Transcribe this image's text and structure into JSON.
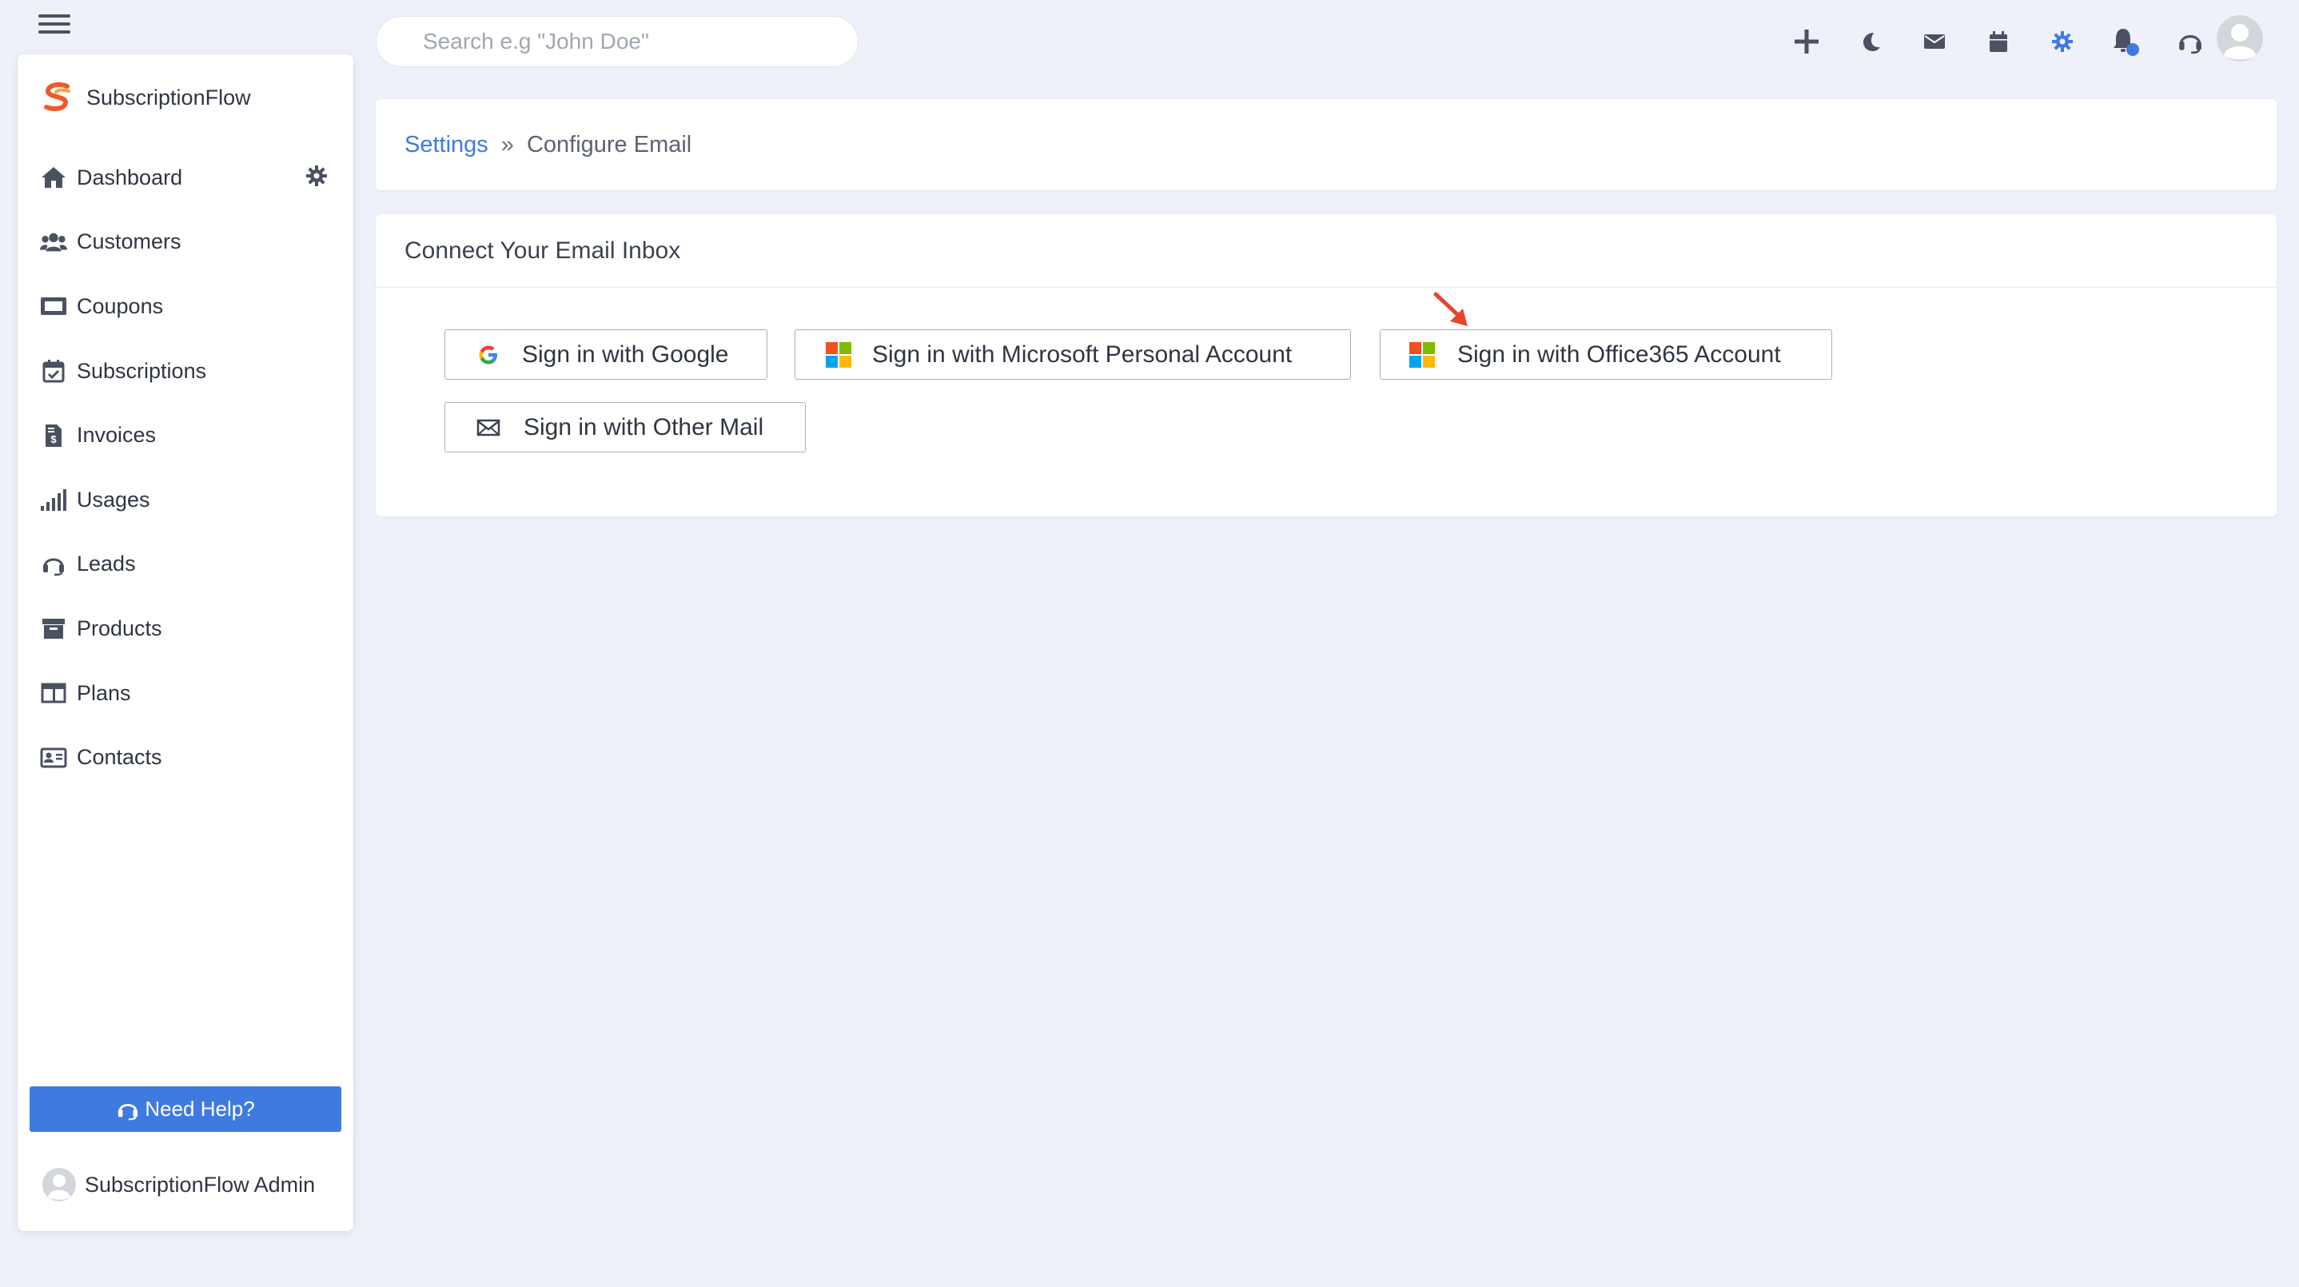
{
  "brand": {
    "name": "SubscriptionFlow"
  },
  "search": {
    "placeholder": "Search e.g \"John Doe\""
  },
  "sidebar": {
    "items": [
      {
        "label": "Dashboard",
        "icon": "home-icon"
      },
      {
        "label": "Customers",
        "icon": "users-icon"
      },
      {
        "label": "Coupons",
        "icon": "ticket-icon"
      },
      {
        "label": "Subscriptions",
        "icon": "calendar-check-icon"
      },
      {
        "label": "Invoices",
        "icon": "invoice-icon"
      },
      {
        "label": "Usages",
        "icon": "signal-bars-icon"
      },
      {
        "label": "Leads",
        "icon": "headset-icon"
      },
      {
        "label": "Products",
        "icon": "archive-box-icon"
      },
      {
        "label": "Plans",
        "icon": "columns-icon"
      },
      {
        "label": "Contacts",
        "icon": "contact-card-icon"
      }
    ],
    "help_label": "Need Help?",
    "admin_name": "SubscriptionFlow Admin"
  },
  "topbar": {
    "icons": [
      "plus-icon",
      "moon-icon",
      "envelope-icon",
      "calendar-icon",
      "gear-icon",
      "bell-icon",
      "headset-icon",
      "user-avatar-icon"
    ]
  },
  "breadcrumb": {
    "parent": "Settings",
    "separator": "»",
    "current": "Configure Email"
  },
  "card": {
    "title": "Connect Your Email Inbox",
    "buttons": {
      "google": "Sign in with Google",
      "microsoft": "Sign in with Microsoft Personal Account",
      "office365": "Sign in with Office365 Account",
      "other": "Sign in with Other Mail"
    }
  },
  "colors": {
    "accent": "#3f7ae0",
    "background": "#eef1f9",
    "brand_orange": "#f05a28",
    "annotation_arrow": "#e8452c",
    "ms_red": "#f25022",
    "ms_green": "#7fba00",
    "ms_blue": "#00a4ef",
    "ms_yellow": "#ffb900"
  }
}
